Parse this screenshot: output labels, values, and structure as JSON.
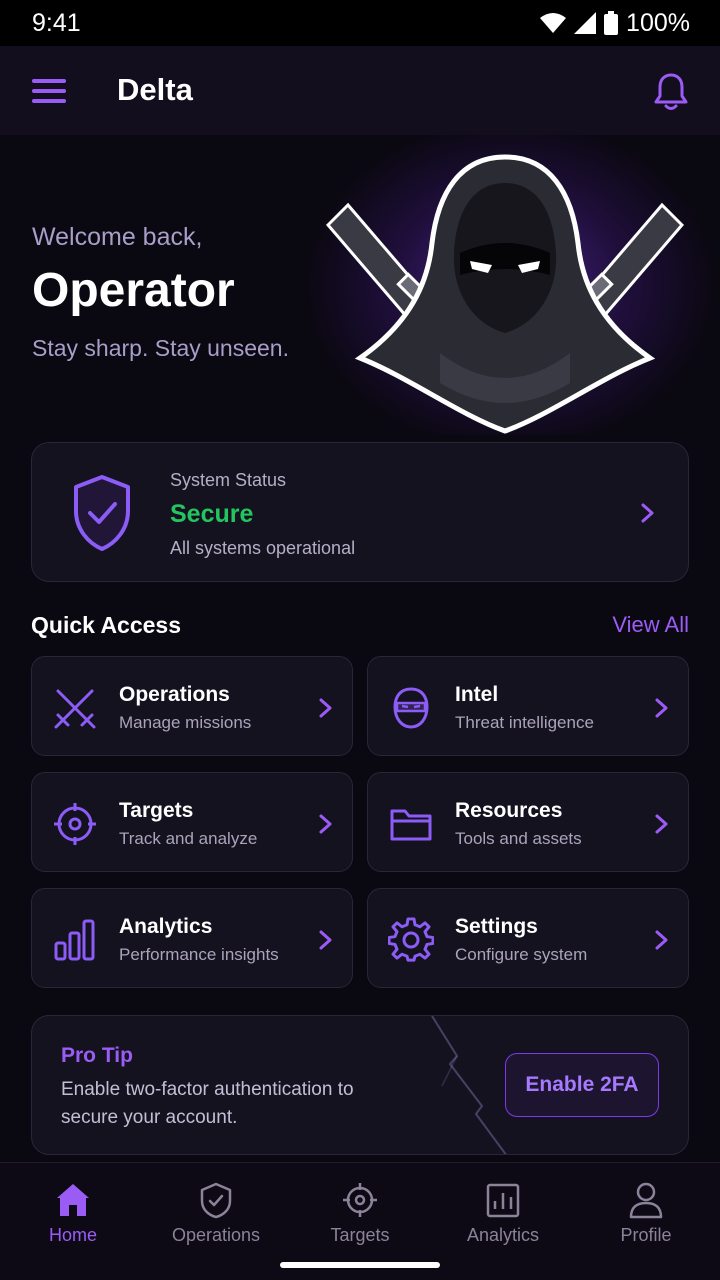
{
  "status_bar": {
    "time": "9:41",
    "battery": "100%"
  },
  "app_bar": {
    "title": "Delta"
  },
  "hero": {
    "greeting": "Welcome back,",
    "name": "Operator",
    "tagline": "Stay sharp. Stay unseen."
  },
  "system_status": {
    "label": "System Status",
    "value": "Secure",
    "subtitle": "All systems operational",
    "value_color": "#22c55e"
  },
  "quick_access": {
    "title": "Quick Access",
    "view_all": "View All",
    "items": [
      {
        "title": "Operations",
        "subtitle": "Manage missions",
        "icon": "crossed-swords-icon"
      },
      {
        "title": "Intel",
        "subtitle": "Threat intelligence",
        "icon": "ninja-mask-icon"
      },
      {
        "title": "Targets",
        "subtitle": "Track and analyze",
        "icon": "crosshair-icon"
      },
      {
        "title": "Resources",
        "subtitle": "Tools and assets",
        "icon": "folder-icon"
      },
      {
        "title": "Analytics",
        "subtitle": "Performance insights",
        "icon": "bar-chart-icon"
      },
      {
        "title": "Settings",
        "subtitle": "Configure system",
        "icon": "gear-icon"
      }
    ]
  },
  "pro_tip": {
    "title": "Pro Tip",
    "text": "Enable two-factor authentication to secure your account.",
    "button": "Enable 2FA"
  },
  "bottom_nav": {
    "items": [
      {
        "label": "Home",
        "icon": "home-icon",
        "active": true
      },
      {
        "label": "Operations",
        "icon": "shield-check-icon",
        "active": false
      },
      {
        "label": "Targets",
        "icon": "crosshair-icon",
        "active": false
      },
      {
        "label": "Analytics",
        "icon": "bar-chart-icon",
        "active": false
      },
      {
        "label": "Profile",
        "icon": "person-icon",
        "active": false
      }
    ]
  },
  "colors": {
    "accent": "#9b5cf6",
    "background": "#0a0810",
    "card": "#15121f",
    "success": "#22c55e"
  }
}
